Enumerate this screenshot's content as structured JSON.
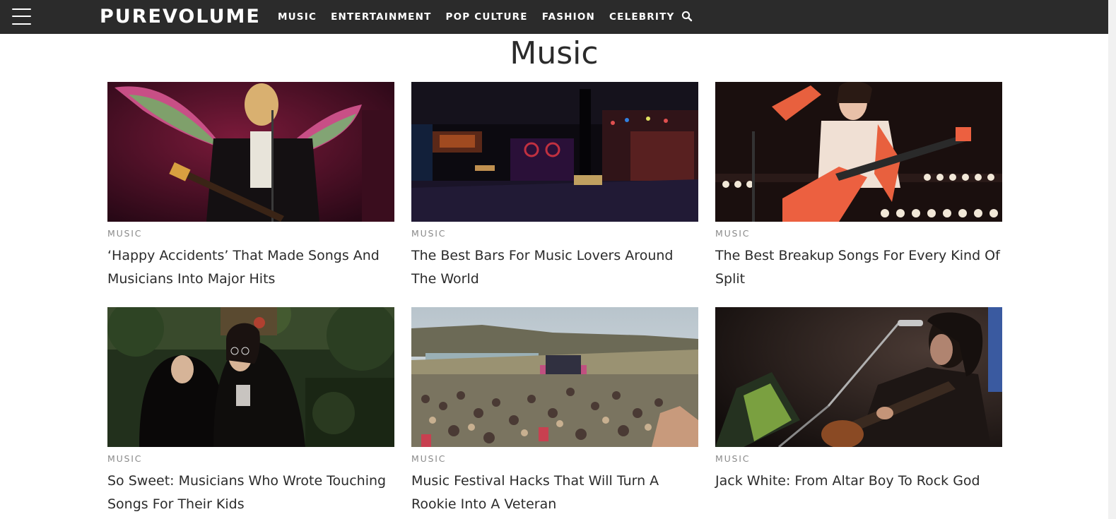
{
  "header": {
    "logo": "PUREVOLUME",
    "nav": [
      {
        "label": "MUSIC"
      },
      {
        "label": "ENTERTAINMENT"
      },
      {
        "label": "POP CULTURE"
      },
      {
        "label": "FASHION"
      },
      {
        "label": "CELEBRITY"
      }
    ],
    "menu_icon": "hamburger-menu-icon",
    "search_icon": "search-icon",
    "background": "#2b2b2b"
  },
  "page": {
    "title": "Music"
  },
  "articles": [
    {
      "category": "MUSIC",
      "title": "‘Happy Accidents’ That Made Songs And Musicians Into Major Hits"
    },
    {
      "category": "MUSIC",
      "title": "The Best Bars For Music Lovers Around The World"
    },
    {
      "category": "MUSIC",
      "title": "The Best Breakup Songs For Every Kind Of Split"
    },
    {
      "category": "MUSIC",
      "title": "So Sweet: Musicians Who Wrote Touching Songs For Their Kids"
    },
    {
      "category": "MUSIC",
      "title": "Music Festival Hacks That Will Turn A Rookie Into A Veteran"
    },
    {
      "category": "MUSIC",
      "title": "Jack White: From Altar Boy To Rock God"
    }
  ]
}
